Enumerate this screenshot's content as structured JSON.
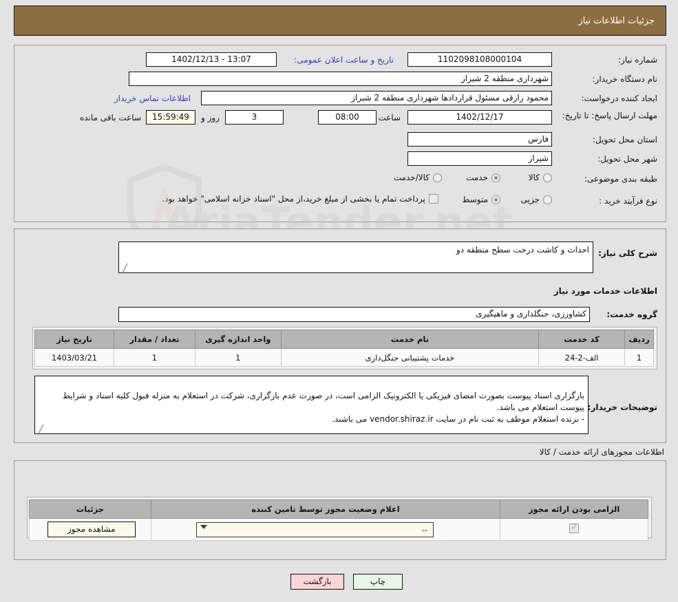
{
  "header": {
    "title": "جزئیات اطلاعات نیاز"
  },
  "watermark": {
    "text": "AriaTender.net"
  },
  "top": {
    "need_number_label": "شماره نیاز:",
    "need_number_value": "1102098108000104",
    "announce_label": "تاریخ و ساعت اعلان عمومی:",
    "announce_value": "1402/12/13 - 13:07",
    "buyer_org_label": "نام دستگاه خریدار:",
    "buyer_org_value": "شهرداری منطقه 2 شیراز",
    "requester_label": "ایجاد کننده درخواست:",
    "requester_value": "محمود رازقی مسئول قراردادها شهرداری منطقه 2 شیراز",
    "contact_link": "اطلاعات تماس خریدار",
    "deadline_label": "مهلت ارسال پاسخ: تا تاریخ:",
    "deadline_date": "1402/12/17",
    "hour_label": "ساعت",
    "deadline_time": "08:00",
    "days_value": "3",
    "days_suffix": "روز و",
    "countdown_value": "15:59:49",
    "countdown_suffix": "ساعت باقی مانده",
    "province_label": "استان محل تحویل:",
    "province_value": "فارس",
    "city_label": "شهر محل تحویل:",
    "city_value": "شیراز",
    "category_label": "طبقه بندی موضوعی:",
    "category_options": [
      {
        "label": "کالا",
        "selected": false
      },
      {
        "label": "خدمت",
        "selected": true
      },
      {
        "label": "کالا/خدمت",
        "selected": false
      }
    ],
    "process_label": "نوع فرآیند خرید :",
    "process_options": [
      {
        "label": "جزیی",
        "selected": false
      },
      {
        "label": "متوسط",
        "selected": true
      }
    ],
    "treasury_checkbox_checked": false,
    "treasury_text": "پرداخت تمام یا بخشی از مبلغ خرید،از محل \"اسناد خزانه اسلامی\" خواهد بود."
  },
  "middle": {
    "general_desc_label": "شرح کلی نیاز:",
    "general_desc_value": "احداث و کاشت درخت سطح منطقه دو",
    "services_info_heading": "اطلاعات خدمات مورد نیاز",
    "service_group_label": "گروه خدمت:",
    "service_group_value": "کشاورزی، جنگلداری و ماهیگیری",
    "services_table": {
      "columns": [
        "ردیف",
        "کد خدمت",
        "نام خدمت",
        "واحد اندازه گیری",
        "تعداد / مقدار",
        "تاریخ نیاز"
      ],
      "rows": [
        {
          "row": "1",
          "code": "الف-2-24",
          "name": "خدمات پشتیبانی جنگل‌داری",
          "unit": "1",
          "quantity": "1",
          "date": "1403/03/21"
        }
      ]
    },
    "buyer_notes_label": "توضیحات خریدار:",
    "buyer_notes_value": "بارگزاری اسناد پیوست بصورت امضای فیزیکی یا الکترونیک الزامی است، در صورت عدم بارگزاری، شرکت در استعلام به منزله قبول کلیه اسناد و شرایط پیوست استعلام می باشد.\n- برنده استعلام موظف به ثبت نام در سایت vendor.shiraz.ir می باشند."
  },
  "licenses": {
    "section_heading": "اطلاعات مجوزهای ارائه خدمت / کالا",
    "table": {
      "columns": [
        "الزامی بودن ارائه مجوز",
        "اعلام وضعیت مجوز توسط تامین کننده",
        "جزئیات"
      ],
      "rows": [
        {
          "required_checked": true,
          "status_value": "--",
          "detail_button": "مشاهده مجوز"
        }
      ]
    }
  },
  "footer": {
    "print_button": "چاپ",
    "back_button": "بازگشت"
  },
  "colors": {
    "header_bar": "#8d6e40",
    "page_bg": "#e3e3e3",
    "link": "#2b3fbf",
    "table_header": "#b5b5b5",
    "print_button": "#e8f6e5",
    "back_button": "#fbd6d6",
    "highlight_field": "#fbfbe8"
  }
}
